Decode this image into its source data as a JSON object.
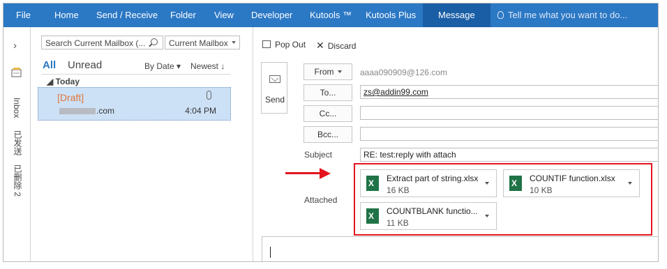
{
  "ribbon": {
    "tabs": [
      {
        "label": "File"
      },
      {
        "label": "Home"
      },
      {
        "label": "Send / Receive"
      },
      {
        "label": "Folder"
      },
      {
        "label": "View"
      },
      {
        "label": "Developer"
      },
      {
        "label": "Kutools ™"
      },
      {
        "label": "Kutools Plus"
      },
      {
        "label": "Message"
      }
    ],
    "active_tab": "Message",
    "tell_me": "Tell me what you want to do...",
    "color": "#2b78c5"
  },
  "nav": {
    "expand_glyph": "›",
    "folders": [
      "Inbox",
      "已发送",
      "已删除 2"
    ]
  },
  "list": {
    "search_placeholder": "Search Current Mailbox (...",
    "scope": "Current Mailbox",
    "filter_all": "All",
    "filter_unread": "Unread",
    "sort_by": "By Date ▾",
    "sort_order": "Newest ↓",
    "group_header": "◢ Today",
    "message": {
      "title": "[Draft]",
      "address_suffix": ".com",
      "time": "4:04 PM"
    }
  },
  "compose": {
    "pop_out": "Pop Out",
    "discard": "Discard",
    "send": "Send",
    "from_label": "From",
    "from_value": "aaaa090909@126.com",
    "to_label": "To...",
    "to_value": "zs@addin99.com",
    "cc_label": "Cc...",
    "bcc_label": "Bcc...",
    "subject_label": "Subject",
    "subject_value": "RE: test:reply with attach",
    "attached_label": "Attached",
    "attachments": [
      {
        "name": "Extract part of string.xlsx",
        "size": "16 KB"
      },
      {
        "name": "COUNTIF function.xlsx",
        "size": "10 KB"
      },
      {
        "name": "COUNTBLANK functio...",
        "size": "11 KB"
      }
    ],
    "highlight_color": "#e3141f"
  }
}
